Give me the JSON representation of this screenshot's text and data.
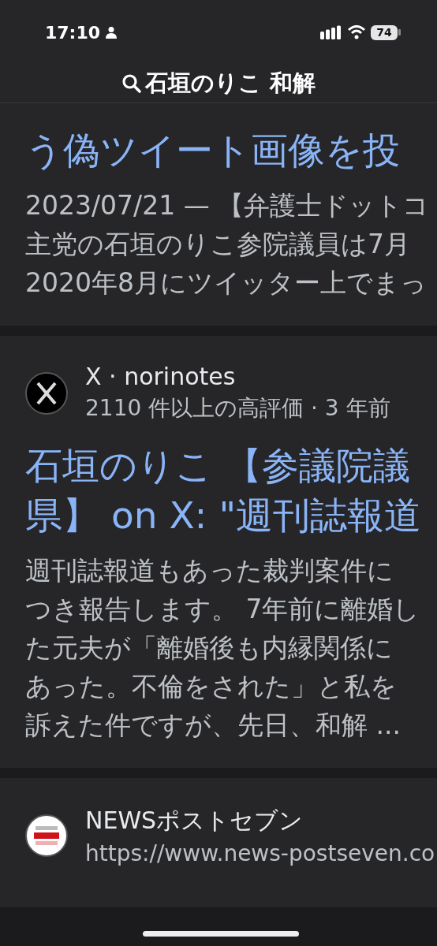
{
  "status_bar": {
    "time": "17:10",
    "battery": "74"
  },
  "search": {
    "query": "石垣のりこ 和解"
  },
  "results": [
    {
      "title_lines": [
        "う偽ツイート画像を投"
      ],
      "snippet_lines": [
        "2023/07/21 — 【弁護士ドットコ",
        "主党の石垣のりこ参院議員は7月",
        "2020年8月にツイッター上でまっ"
      ]
    },
    {
      "source": "X · norinotes",
      "meta": "2110 件以上の高評価 · 3 年前",
      "avatar": {
        "kind": "x"
      },
      "title_lines": [
        "石垣のりこ 【参議院議",
        "県】 on X: \"週刊誌報道"
      ],
      "snippet_lines": [
        "週刊誌報道もあった裁判案件に",
        "つき報告します。 7年前に離婚し",
        "た元夫が「離婚後も内縁関係に",
        "あった。不倫をされた」と私を",
        "訴えた件ですが、先日、和解 ..."
      ]
    },
    {
      "source": "NEWSポストセブン",
      "meta": "https://www.news-postseven.co",
      "avatar": {
        "kind": "news"
      }
    }
  ]
}
